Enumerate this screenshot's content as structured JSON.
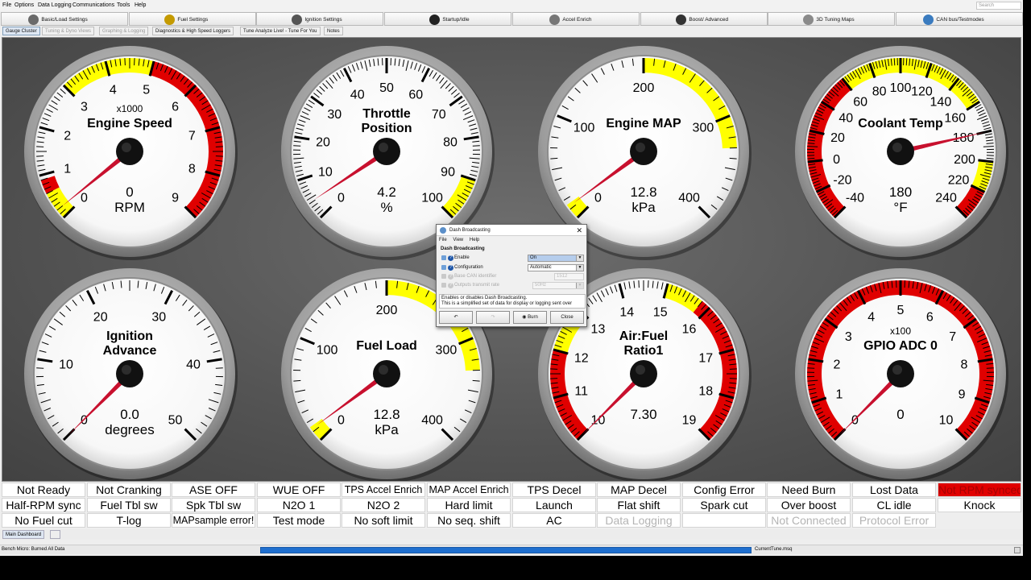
{
  "menu": [
    "File",
    "Options",
    "Data Logging",
    "Communications",
    "Tools",
    "Help"
  ],
  "search_placeholder": "Search",
  "main_tabs": [
    {
      "label": "Basic/Load Settings",
      "icon": "gauge-settings-icon"
    },
    {
      "label": "Fuel Settings",
      "icon": "fuel-pump-icon"
    },
    {
      "label": "Ignition Settings",
      "icon": "spark-plug-icon"
    },
    {
      "label": "Startup/Idle",
      "icon": "startup-gauge-icon"
    },
    {
      "label": "Accel Enrich",
      "icon": "accelerator-icon"
    },
    {
      "label": "Boost/ Advanced",
      "icon": "turbo-icon"
    },
    {
      "label": "3D Tuning Maps",
      "icon": "3d-map-icon"
    },
    {
      "label": "CAN bus/Testmodes",
      "icon": "network-icon"
    }
  ],
  "sub_tabs": [
    {
      "label": "Gauge Cluster",
      "state": "active"
    },
    {
      "label": "Tuning & Dyno Views",
      "state": "dim"
    },
    {
      "label": "Graphing & Logging",
      "state": "dim"
    },
    {
      "label": "Diagnostics & High Speed Loggers",
      "state": "normal"
    },
    {
      "label": "Tune Analyze Live! - Tune For You",
      "state": "normal"
    },
    {
      "label": "Notes",
      "state": "normal"
    }
  ],
  "colors": {
    "warn": "#ffff00",
    "danger": "#e00000",
    "needle": "#c8102e",
    "bezel": "#9a9a9a"
  },
  "gauges": [
    {
      "title": [
        "Engine Speed"
      ],
      "units_mult": "x1000",
      "value": "0",
      "units": "RPM",
      "needle_value": 0.2,
      "min": 0,
      "max": 9,
      "ticks": [
        "0",
        "1",
        "2",
        "3",
        "4",
        "5",
        "6",
        "7",
        "8",
        "9"
      ],
      "bands": [
        {
          "from": 0,
          "to": 0.6,
          "color": "warn"
        },
        {
          "from": 0.6,
          "to": 0.9,
          "color": "danger"
        },
        {
          "from": 3,
          "to": 5,
          "color": "warn"
        },
        {
          "from": 5,
          "to": 9,
          "color": "danger"
        }
      ]
    },
    {
      "title": [
        "Throttle",
        "Position"
      ],
      "units_mult": "",
      "value": "4.2",
      "units": "%",
      "needle_value": 4.2,
      "min": 0,
      "max": 100,
      "ticks": [
        "0",
        "10",
        "20",
        "30",
        "40",
        "50",
        "60",
        "70",
        "80",
        "90",
        "100"
      ],
      "bands": [
        {
          "from": 90,
          "to": 100,
          "color": "warn"
        }
      ]
    },
    {
      "title": [
        "Engine MAP"
      ],
      "units_mult": "",
      "value": "12.8",
      "units": "kPa",
      "needle_value": 12.8,
      "min": 0,
      "max": 400,
      "ticks": [
        "0",
        "100",
        "200",
        "300",
        "400"
      ],
      "bands": [
        {
          "from": 0,
          "to": 15,
          "color": "warn"
        },
        {
          "from": 200,
          "to": 330,
          "color": "warn"
        }
      ]
    },
    {
      "title": [
        "Coolant Temp"
      ],
      "units_mult": "",
      "value": "180",
      "units": "°F",
      "needle_value": 180,
      "min": -40,
      "max": 240,
      "ticks": [
        "-40",
        "-20",
        "0",
        "20",
        "40",
        "60",
        "80",
        "100",
        "120",
        "140",
        "160",
        "180",
        "200",
        "220",
        "240"
      ],
      "bands": [
        {
          "from": -40,
          "to": 60,
          "color": "danger"
        },
        {
          "from": 60,
          "to": 160,
          "color": "warn"
        },
        {
          "from": 200,
          "to": 220,
          "color": "warn"
        },
        {
          "from": 220,
          "to": 240,
          "color": "danger"
        }
      ]
    },
    {
      "title": [
        "Ignition",
        "Advance"
      ],
      "units_mult": "",
      "value": "0.0",
      "units": "degrees",
      "needle_value": 0,
      "min": 0,
      "max": 50,
      "ticks": [
        "0",
        "10",
        "20",
        "30",
        "40",
        "50"
      ],
      "bands": []
    },
    {
      "title": [
        "Fuel Load"
      ],
      "units_mult": "",
      "value": "12.8",
      "units": "kPa",
      "needle_value": 12.8,
      "min": 0,
      "max": 400,
      "ticks": [
        "0",
        "100",
        "200",
        "300",
        "400"
      ],
      "bands": [
        {
          "from": 0,
          "to": 15,
          "color": "warn"
        },
        {
          "from": 200,
          "to": 330,
          "color": "warn"
        }
      ]
    },
    {
      "title": [
        "Air:Fuel",
        "Ratio1"
      ],
      "units_mult": "",
      "value": "7.30",
      "units": "",
      "needle_value": 10,
      "min": 10,
      "max": 19,
      "ticks": [
        "10",
        "11",
        "12",
        "13",
        "14",
        "15",
        "16",
        "17",
        "18",
        "19"
      ],
      "bands": [
        {
          "from": 10,
          "to": 12,
          "color": "danger"
        },
        {
          "from": 12,
          "to": 13,
          "color": "warn"
        },
        {
          "from": 15,
          "to": 15.8,
          "color": "warn"
        },
        {
          "from": 15.8,
          "to": 19,
          "color": "danger"
        }
      ]
    },
    {
      "title": [
        "GPIO ADC 0"
      ],
      "units_mult": "x100",
      "value": "0",
      "units": "",
      "needle_value": 0,
      "min": 0,
      "max": 10,
      "ticks": [
        "0",
        "1",
        "2",
        "3",
        "4",
        "5",
        "6",
        "7",
        "8",
        "9",
        "10"
      ],
      "bands": [
        {
          "from": 0,
          "to": 10,
          "color": "danger"
        }
      ]
    }
  ],
  "indicators": [
    [
      {
        "label": "Not Ready"
      },
      {
        "label": "Not Cranking"
      },
      {
        "label": "ASE OFF"
      },
      {
        "label": "WUE OFF"
      },
      {
        "label": "TPS Accel Enrich",
        "style": "med"
      },
      {
        "label": "MAP Accel Enrich",
        "style": "med"
      },
      {
        "label": "TPS Decel"
      },
      {
        "label": "MAP Decel"
      },
      {
        "label": "Config Error"
      },
      {
        "label": "Need Burn"
      },
      {
        "label": "Lost Data"
      },
      {
        "label": "Not RPM synced",
        "style": "red"
      }
    ],
    [
      {
        "label": "Half-RPM sync"
      },
      {
        "label": "Fuel Tbl sw"
      },
      {
        "label": "Spk Tbl sw"
      },
      {
        "label": "N2O 1"
      },
      {
        "label": "N2O 2"
      },
      {
        "label": "Hard limit"
      },
      {
        "label": "Launch"
      },
      {
        "label": "Flat shift"
      },
      {
        "label": "Spark cut"
      },
      {
        "label": "Over boost"
      },
      {
        "label": "CL idle"
      },
      {
        "label": "Knock"
      }
    ],
    [
      {
        "label": "No Fuel cut"
      },
      {
        "label": "T-log"
      },
      {
        "label": "MAPsample error!",
        "style": "med"
      },
      {
        "label": "Test mode"
      },
      {
        "label": "No soft limit"
      },
      {
        "label": "No seq. shift"
      },
      {
        "label": "AC"
      },
      {
        "label": "Data Logging",
        "style": "dim"
      },
      {
        "label": ""
      },
      {
        "label": "Not Connected",
        "style": "dim"
      },
      {
        "label": "Protocol Error",
        "style": "dim"
      }
    ]
  ],
  "dialog": {
    "title": "Dash Broadcasting",
    "menu": [
      "File",
      "View",
      "Help"
    ],
    "section": "Dash Broadcasting",
    "rows": [
      {
        "label": "Enable",
        "value": "On",
        "enabled": true
      },
      {
        "label": "Configuration",
        "value": "Automatic",
        "enabled": true
      },
      {
        "label": "Base CAN identifier",
        "value": "1512",
        "enabled": false
      },
      {
        "label": "Outputs transmit rate",
        "value": "50Hz",
        "enabled": false
      }
    ],
    "help": [
      "Enables or disables Dash Broadcasting.",
      "This is a simplified set of data for display or logging sent over"
    ],
    "buttons": {
      "undo": "undo-icon",
      "redo": "redo-icon",
      "burn": "Burn",
      "close": "Close"
    }
  },
  "bottom_tab": "Main Dashboard",
  "status": {
    "left": "Bench Micro: Burned All Data",
    "progress": 1.0,
    "file": "CurrentTune.msq"
  }
}
